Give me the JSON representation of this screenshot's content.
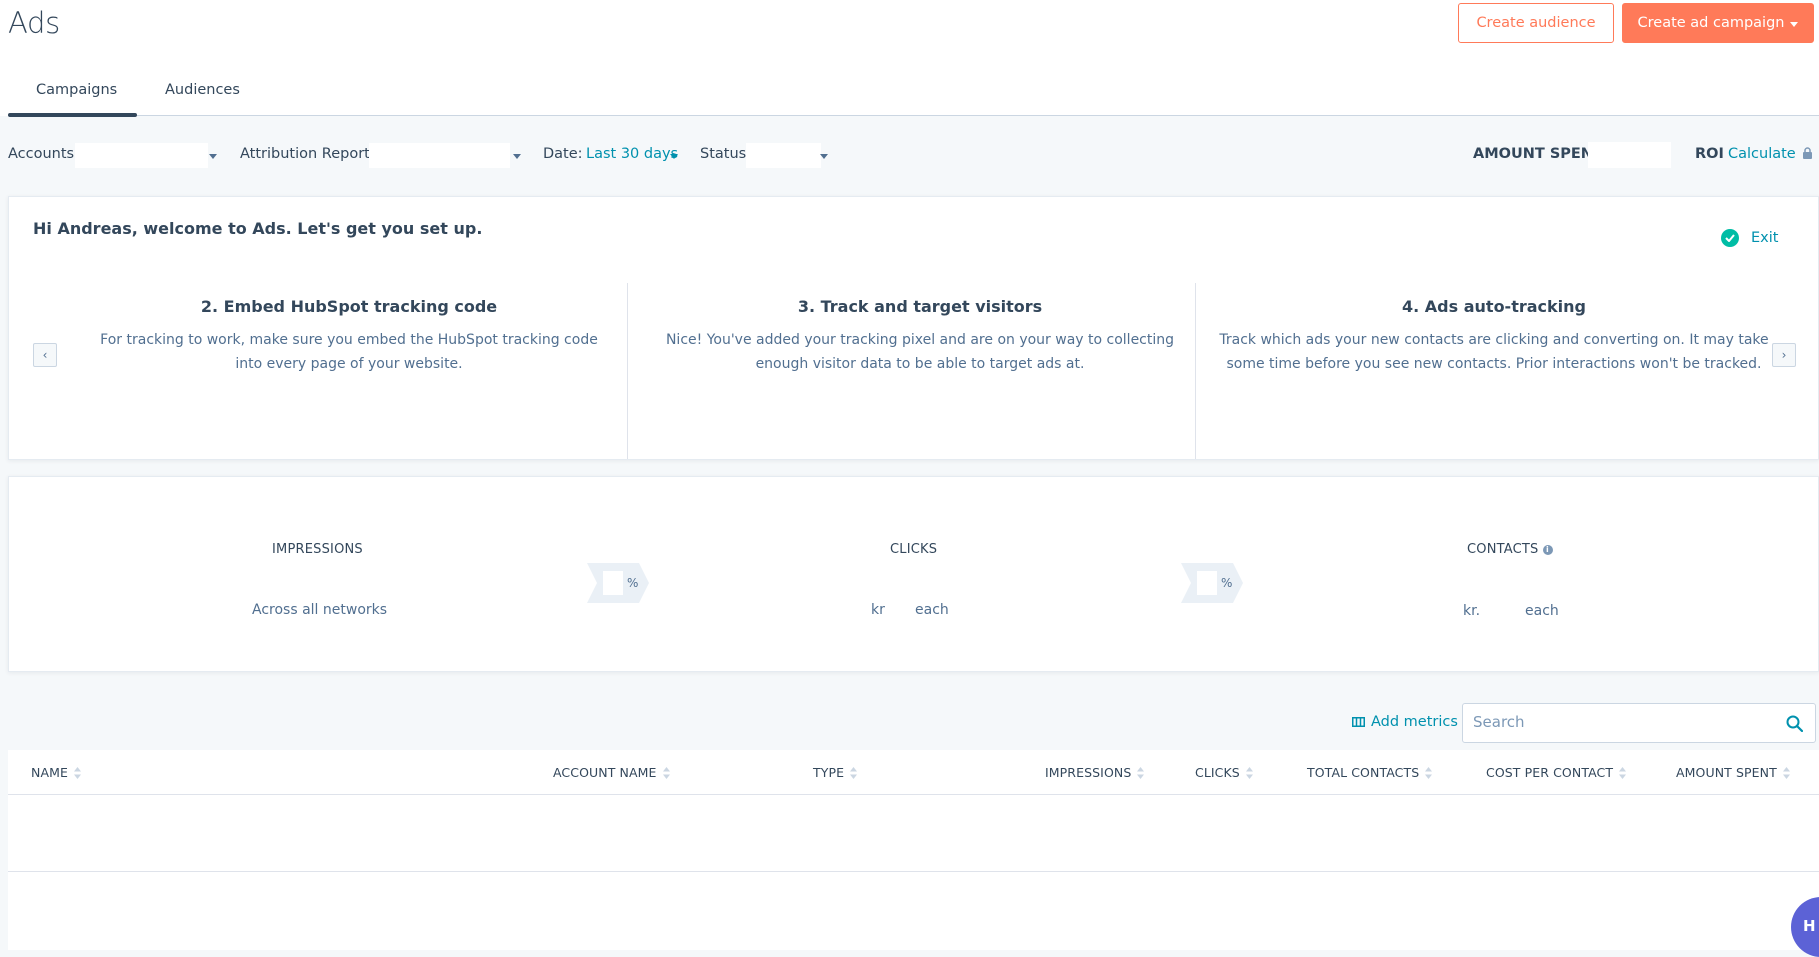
{
  "header": {
    "title": "Ads",
    "create_audience_label": "Create audience",
    "create_campaign_label": "Create ad campaign"
  },
  "tabs": [
    {
      "label": "Campaigns",
      "active": true
    },
    {
      "label": "Audiences",
      "active": false
    }
  ],
  "filters": {
    "accounts_label": "Accounts:",
    "attribution_label": "Attribution Reports:",
    "date_label": "Date:",
    "date_value": "Last 30 days",
    "status_label": "Status:",
    "amount_spent_label": "AMOUNT SPENT",
    "roi_label": "ROI",
    "roi_link": "Calculate"
  },
  "welcome": {
    "greeting": "Hi Andreas, welcome to Ads. Let's get you set up.",
    "exit_label": "Exit",
    "steps": [
      {
        "title": "2. Embed HubSpot tracking code",
        "desc": "For tracking to work, make sure you embed the HubSpot tracking code into every page of your website."
      },
      {
        "title": "3. Track and target visitors",
        "desc": "Nice! You've added your tracking pixel and are on your way to collecting enough visitor data to be able to target ads at."
      },
      {
        "title": "4. Ads auto-tracking",
        "desc": "Track which ads your new contacts are clicking and converting on. It may take some time before you see new contacts. Prior interactions won't be tracked."
      }
    ]
  },
  "metrics": {
    "impressions_label": "IMPRESSIONS",
    "impressions_sub": "Across all networks",
    "clicks_label": "CLICKS",
    "clicks_currency": "kr",
    "clicks_each": "each",
    "contacts_label": "CONTACTS",
    "contacts_currency": "kr.",
    "contacts_each": "each",
    "percent_symbol": "%"
  },
  "table_controls": {
    "add_metrics_label": "Add metrics",
    "search_placeholder": "Search"
  },
  "table": {
    "columns": [
      "NAME",
      "ACCOUNT NAME",
      "TYPE",
      "IMPRESSIONS",
      "CLICKS",
      "TOTAL CONTACTS",
      "COST PER CONTACT",
      "AMOUNT SPENT"
    ]
  },
  "chat": {
    "label": "H"
  },
  "colors": {
    "accent_orange": "#ff7a59",
    "link_teal": "#0091ae",
    "text_dark": "#33475b",
    "success_green": "#00bda5",
    "background": "#f5f8fa"
  }
}
